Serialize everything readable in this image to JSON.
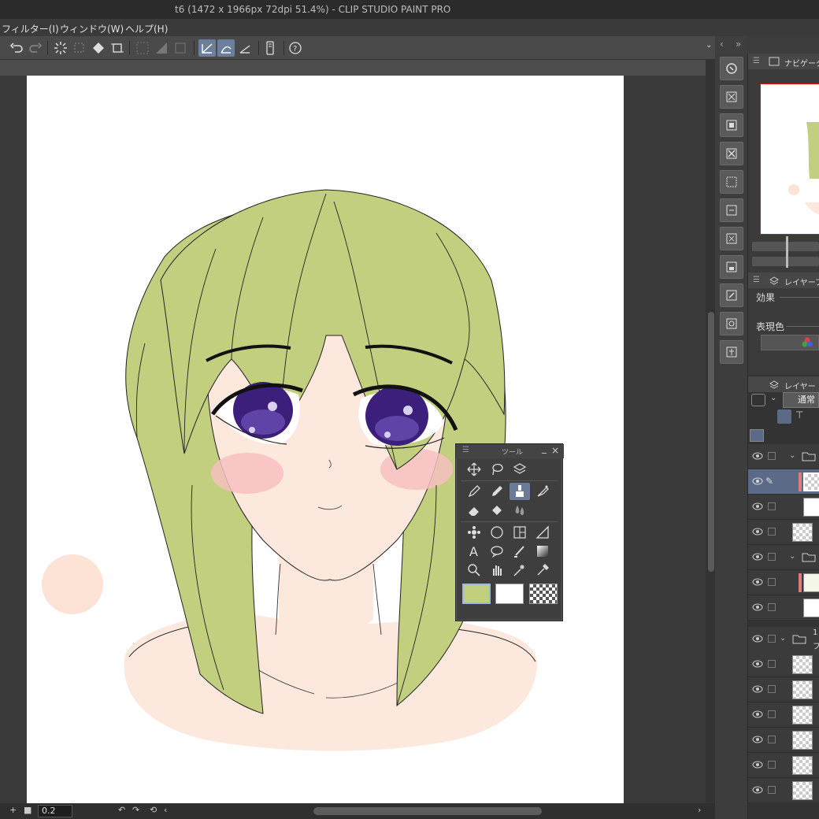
{
  "window": {
    "title": "t6 (1472 x 1966px 72dpi 51.4%)  - CLIP STUDIO PAINT PRO"
  },
  "menu": {
    "items": [
      "フィルター(I)",
      "ウィンドウ(W)",
      "ヘルプ(H)"
    ]
  },
  "status": {
    "zoom_value": "0.2"
  },
  "panels": {
    "navigator": {
      "title": "ナビゲーター"
    },
    "layer_property": {
      "title": "レイヤープロ",
      "effect_label": "効果",
      "expression_color_label": "表現色"
    },
    "layers": {
      "title": "レイヤー",
      "blend_mode": "通常",
      "folder_label_partial": "1",
      "folder_label_partial2": "フ"
    }
  },
  "tool_palette": {
    "title": "ツール",
    "main_color": "#c2cf7e",
    "sub_color": "#ffffff"
  },
  "colors": {
    "hair": "#c2cf7e",
    "skin": "#fde8de",
    "blush": "#f7c0bf",
    "iris": "#3b1f7a",
    "accent_selection": "#5b6a87"
  }
}
